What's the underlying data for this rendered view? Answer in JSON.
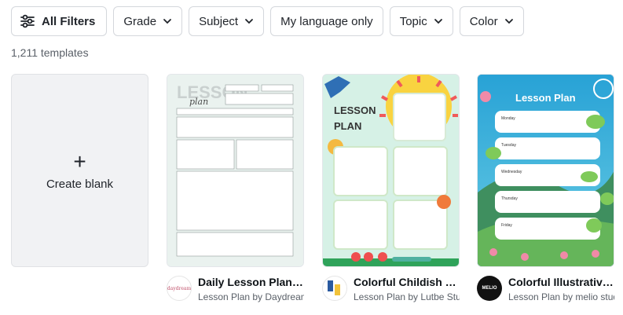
{
  "filters": {
    "all_filters": "All Filters",
    "grade": "Grade",
    "subject": "Subject",
    "language": "My language only",
    "topic": "Topic",
    "color": "Color"
  },
  "results": {
    "count": "1,211 templates"
  },
  "create_blank": {
    "label": "Create blank"
  },
  "templates": [
    {
      "title": "Daily Lesson Plan Worksheet",
      "subtitle": "Lesson Plan by Daydreams",
      "thumb_heading": "LESSON",
      "thumb_script": "plan",
      "avatar_text": "daydream"
    },
    {
      "title": "Colorful Childish Lesson Plan",
      "subtitle": "Lesson Plan by Lutbe Studio",
      "thumb_heading_1": "LESSON",
      "thumb_heading_2": "PLAN"
    },
    {
      "title": "Colorful Illustrative Lesson Plan",
      "subtitle": "Lesson Plan by melio studio",
      "thumb_heading": "Lesson Plan",
      "days": [
        "Monday",
        "Tuesday",
        "Wednesday",
        "Thursday",
        "Friday"
      ],
      "avatar_text": "MELIO"
    }
  ],
  "colors": {
    "brand_border": "#d4d7dc",
    "thumb2_bg": "#cfeee1",
    "thumb3_sky": "#2aa3cf"
  }
}
